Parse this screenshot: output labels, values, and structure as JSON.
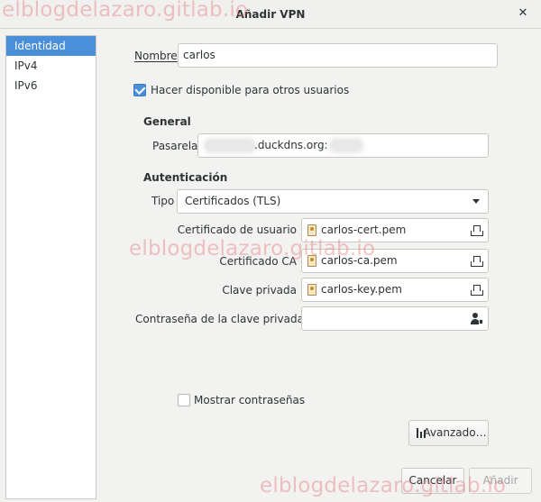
{
  "window": {
    "title": "Añadir VPN",
    "close_glyph": "✕"
  },
  "watermark": "elblogdelazaro.gitlab.io",
  "sidebar": {
    "items": [
      {
        "label": "Identidad",
        "active": true
      },
      {
        "label": "IPv4",
        "active": false
      },
      {
        "label": "IPv6",
        "active": false
      }
    ]
  },
  "form": {
    "nombre_label": "Nombre",
    "nombre_value": "carlos",
    "share_checkbox_label": "Hacer disponible para otros usuarios",
    "share_checked": true,
    "general_heading": "General",
    "pasarela_label": "Pasarela",
    "pasarela_value": ".duckdns.org:",
    "auth_heading": "Autenticación",
    "tipo_label": "Tipo",
    "tipo_value": "Certificados (TLS)",
    "user_cert_label": "Certificado de usuario",
    "user_cert_value": "carlos-cert.pem",
    "ca_cert_label": "Certificado CA",
    "ca_cert_value": "carlos-ca.pem",
    "key_label": "Clave privada",
    "key_value": "carlos-key.pem",
    "key_password_label": "Contraseña de la clave privada",
    "key_password_value": "",
    "show_passwords_label": "Mostrar contraseñas",
    "show_passwords_checked": false,
    "advanced_button": "Avanzado…"
  },
  "footer": {
    "cancel_button": "Cancelar",
    "add_button": "Añadir"
  },
  "colors": {
    "accent": "#4a90d9",
    "background": "#f2f2f1",
    "watermark": "#e87878"
  },
  "icons": {
    "file": "certificate-file-icon",
    "open": "open-file-icon",
    "password": "password-user-icon",
    "advanced": "equalizer-icon",
    "dropdown": "chevron-down-icon"
  }
}
